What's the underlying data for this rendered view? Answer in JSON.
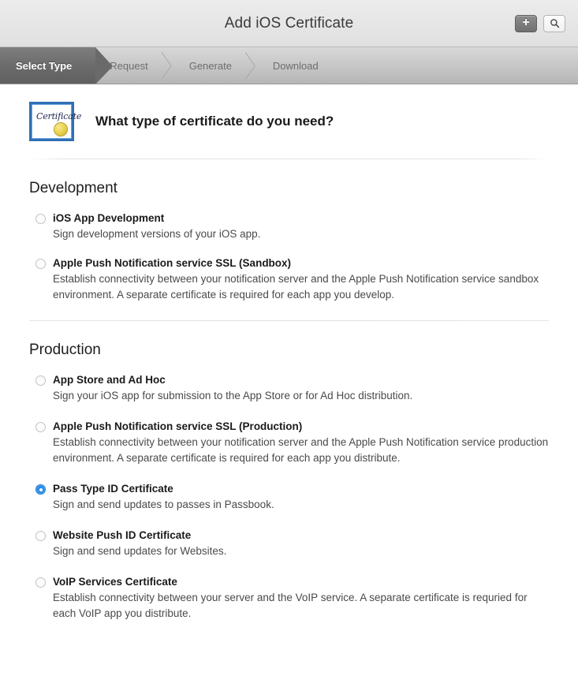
{
  "titlebar": {
    "title": "Add iOS Certificate",
    "add_button_label": "+",
    "add_button_icon": "plus-icon",
    "search_button_icon": "search-icon"
  },
  "steps": [
    {
      "label": "Select Type",
      "active": true
    },
    {
      "label": "Request",
      "active": false
    },
    {
      "label": "Generate",
      "active": false
    },
    {
      "label": "Download",
      "active": false
    }
  ],
  "intro": {
    "icon": "certificate-icon",
    "icon_word": "Certificate",
    "heading": "What type of certificate do you need?"
  },
  "sections": [
    {
      "title": "Development",
      "options": [
        {
          "title": "iOS App Development",
          "desc": "Sign development versions of your iOS app.",
          "selected": false
        },
        {
          "title": "Apple Push Notification service SSL (Sandbox)",
          "desc": "Establish connectivity between your notification server and the Apple Push Notification service sandbox environment. A separate certificate is required for each app you develop.",
          "selected": false
        }
      ]
    },
    {
      "title": "Production",
      "options": [
        {
          "title": "App Store and Ad Hoc",
          "desc": "Sign your iOS app for submission to the App Store or for Ad Hoc distribution.",
          "selected": false
        },
        {
          "title": "Apple Push Notification service SSL (Production)",
          "desc": "Establish connectivity between your notification server and the Apple Push Notification service production environment. A separate certificate is required for each app you distribute.",
          "selected": false
        },
        {
          "title": "Pass Type ID Certificate",
          "desc": "Sign and send updates to passes in Passbook.",
          "selected": true
        },
        {
          "title": "Website Push ID Certificate",
          "desc": "Sign and send updates for Websites.",
          "selected": false
        },
        {
          "title": "VoIP Services Certificate",
          "desc": "Establish connectivity between your server and the VoIP service. A separate certificate is requried for each VoIP app you distribute.",
          "selected": false
        }
      ]
    }
  ],
  "colors": {
    "accent_selected_radio": "#2e8ae6",
    "active_step_bg": "#6a6a6a",
    "titlebar_bg": "#e6e6e6",
    "cert_icon_border": "#2f6fb5",
    "cert_seal": "#e9cf4a"
  }
}
